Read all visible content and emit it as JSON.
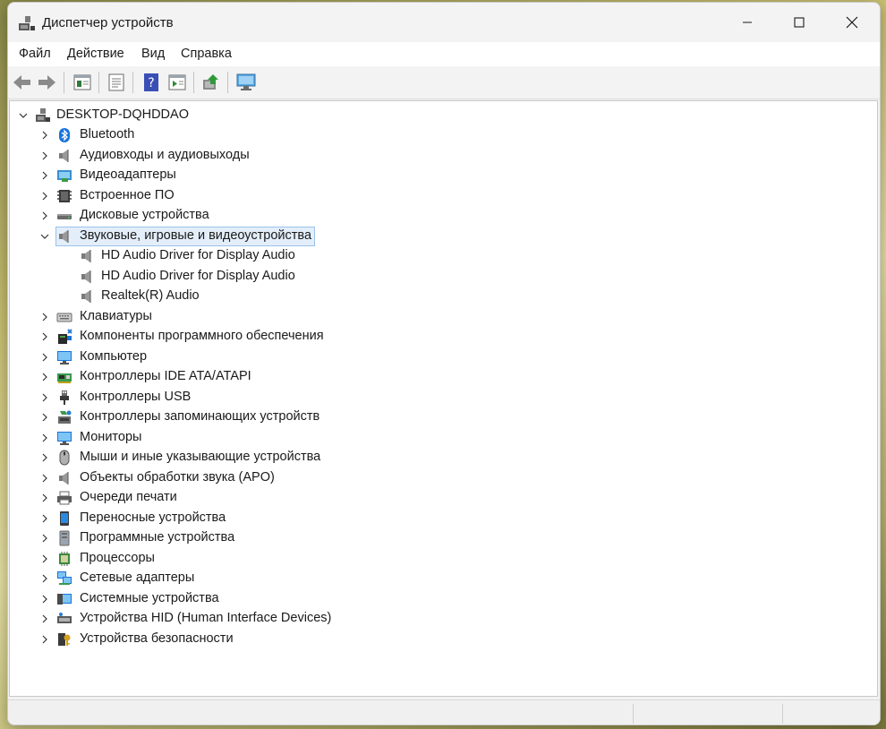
{
  "window": {
    "title": "Диспетчер устройств"
  },
  "menu": [
    "Файл",
    "Действие",
    "Вид",
    "Справка"
  ],
  "toolbar_buttons": [
    "back-icon",
    "forward-icon",
    "show-hide-tree-icon",
    "properties-icon",
    "help-icon",
    "action-pane-icon",
    "update-driver-icon",
    "scan-hardware-icon"
  ],
  "tree": {
    "root": "DESKTOP-DQHDDAO",
    "categories": [
      {
        "label": "Bluetooth",
        "icon": "bluetooth-icon"
      },
      {
        "label": "Аудиовходы и аудиовыходы",
        "icon": "speaker-icon"
      },
      {
        "label": "Видеоадаптеры",
        "icon": "display-adapter-icon"
      },
      {
        "label": "Встроенное ПО",
        "icon": "firmware-icon"
      },
      {
        "label": "Дисковые устройства",
        "icon": "disk-drive-icon"
      },
      {
        "label": "Звуковые, игровые и видеоустройства",
        "icon": "speaker-icon",
        "expanded": true,
        "selected": true,
        "children": [
          "HD Audio Driver for Display Audio",
          "HD Audio Driver for Display Audio",
          "Realtek(R) Audio"
        ]
      },
      {
        "label": "Клавиатуры",
        "icon": "keyboard-icon"
      },
      {
        "label": "Компоненты программного обеспечения",
        "icon": "software-component-icon"
      },
      {
        "label": "Компьютер",
        "icon": "computer-icon"
      },
      {
        "label": "Контроллеры IDE ATA/ATAPI",
        "icon": "ide-controller-icon"
      },
      {
        "label": "Контроллеры USB",
        "icon": "usb-icon"
      },
      {
        "label": "Контроллеры запоминающих устройств",
        "icon": "storage-controller-icon"
      },
      {
        "label": "Мониторы",
        "icon": "monitor-icon"
      },
      {
        "label": "Мыши и иные указывающие устройства",
        "icon": "mouse-icon"
      },
      {
        "label": "Объекты обработки звука (APO)",
        "icon": "speaker-icon"
      },
      {
        "label": "Очереди печати",
        "icon": "printer-icon"
      },
      {
        "label": "Переносные устройства",
        "icon": "portable-device-icon"
      },
      {
        "label": "Программные устройства",
        "icon": "software-device-icon"
      },
      {
        "label": "Процессоры",
        "icon": "processor-icon"
      },
      {
        "label": "Сетевые адаптеры",
        "icon": "network-adapter-icon"
      },
      {
        "label": "Системные устройства",
        "icon": "system-device-icon"
      },
      {
        "label": "Устройства HID (Human Interface Devices)",
        "icon": "hid-icon"
      },
      {
        "label": "Устройства безопасности",
        "icon": "security-device-icon"
      }
    ]
  },
  "colors": {
    "selection_fill": "#e3eefa",
    "selection_border": "#99c3ec",
    "window_bg": "#f3f3f3",
    "tree_bg": "#ffffff"
  }
}
